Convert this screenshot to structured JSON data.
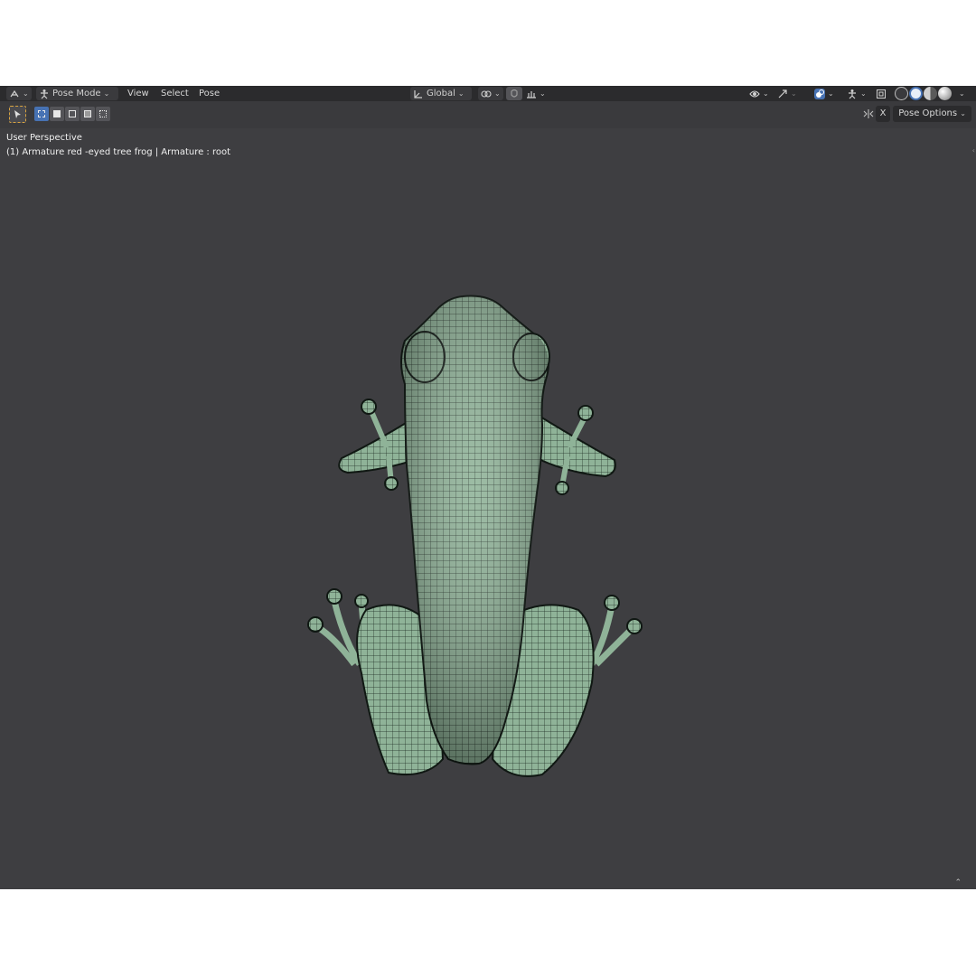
{
  "header": {
    "mode_label": "Pose Mode",
    "menus": [
      "View",
      "Select",
      "Pose"
    ],
    "orientation": "Global"
  },
  "toolbar": {
    "pose_options_label": "Pose Options",
    "x_axis_label": "X"
  },
  "viewport": {
    "perspective_label": "User Perspective",
    "object_info": "(1) Armature red -eyed tree frog | Armature : root",
    "background_color": "#3e3e41",
    "mesh_color": "#8fb398",
    "wire_color": "#1c2a22"
  },
  "icons": [
    "editor-type-icon",
    "pose-mode-icon",
    "transform-pivot-icon",
    "snap-icon",
    "proportional-edit-icon",
    "visibility-icon",
    "gizmo-icon",
    "overlay-icon",
    "xray-icon",
    "wireframe-shading-icon",
    "solid-shading-icon",
    "material-shading-icon",
    "rendered-shading-icon",
    "select-tool-icon"
  ]
}
